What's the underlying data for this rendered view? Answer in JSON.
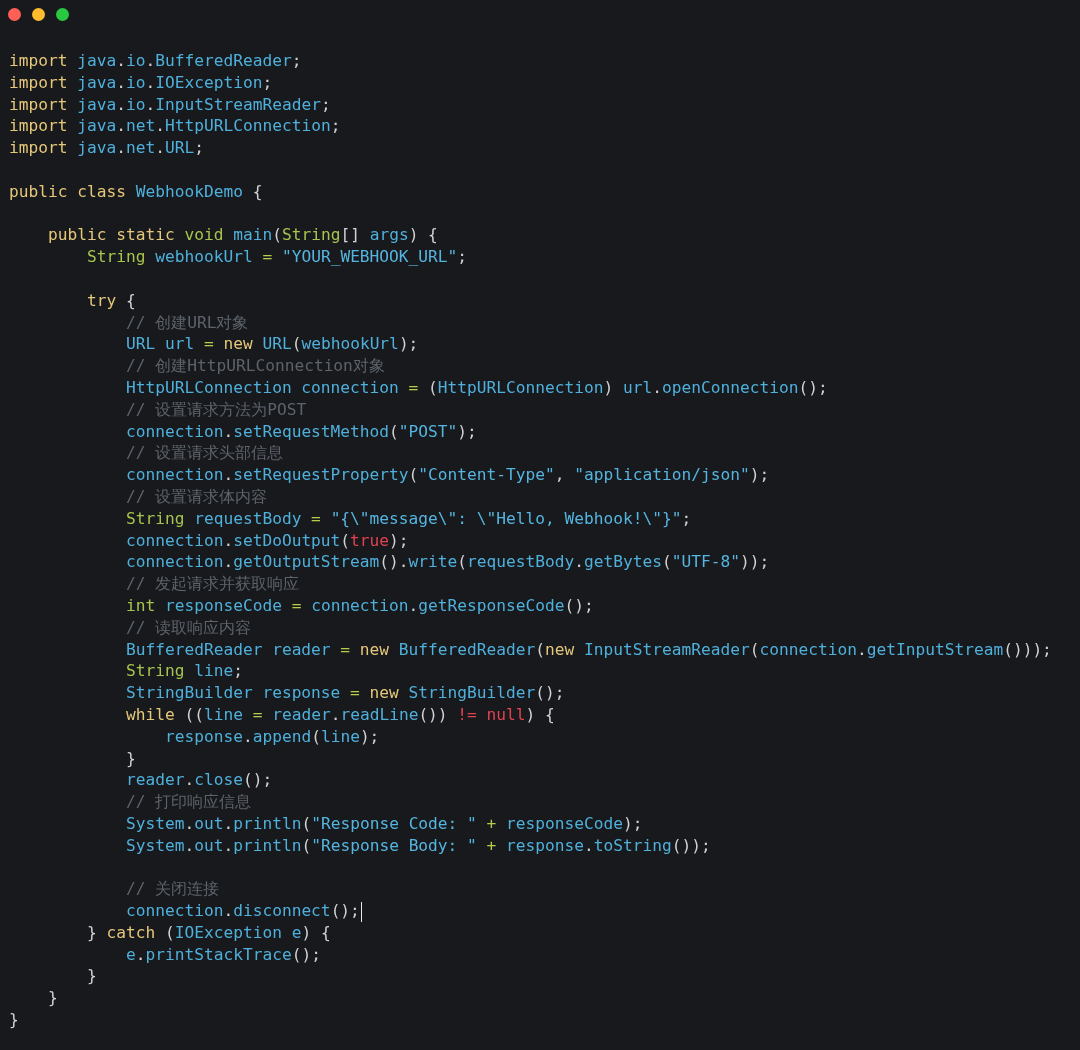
{
  "window": {
    "controls": [
      {
        "color": "#fe5f57"
      },
      {
        "color": "#febc2e"
      },
      {
        "color": "#28c840"
      }
    ]
  },
  "code": {
    "lines": [
      {
        "kind": "code",
        "cursor": false,
        "tokens": [
          {
            "kind": "keyword",
            "text": "import "
          },
          {
            "kind": "name",
            "text": "java"
          },
          {
            "kind": "punct",
            "text": "."
          },
          {
            "kind": "name",
            "text": "io"
          },
          {
            "kind": "punct",
            "text": "."
          },
          {
            "kind": "name",
            "text": "BufferedReader"
          },
          {
            "kind": "punct",
            "text": ";"
          }
        ]
      },
      {
        "kind": "code",
        "cursor": false,
        "tokens": [
          {
            "kind": "keyword",
            "text": "import "
          },
          {
            "kind": "name",
            "text": "java"
          },
          {
            "kind": "punct",
            "text": "."
          },
          {
            "kind": "name",
            "text": "io"
          },
          {
            "kind": "punct",
            "text": "."
          },
          {
            "kind": "name",
            "text": "IOException"
          },
          {
            "kind": "punct",
            "text": ";"
          }
        ]
      },
      {
        "kind": "code",
        "cursor": false,
        "tokens": [
          {
            "kind": "keyword",
            "text": "import "
          },
          {
            "kind": "name",
            "text": "java"
          },
          {
            "kind": "punct",
            "text": "."
          },
          {
            "kind": "name",
            "text": "io"
          },
          {
            "kind": "punct",
            "text": "."
          },
          {
            "kind": "name",
            "text": "InputStreamReader"
          },
          {
            "kind": "punct",
            "text": ";"
          }
        ]
      },
      {
        "kind": "code",
        "cursor": false,
        "tokens": [
          {
            "kind": "keyword",
            "text": "import "
          },
          {
            "kind": "name",
            "text": "java"
          },
          {
            "kind": "punct",
            "text": "."
          },
          {
            "kind": "name",
            "text": "net"
          },
          {
            "kind": "punct",
            "text": "."
          },
          {
            "kind": "name",
            "text": "HttpURLConnection"
          },
          {
            "kind": "punct",
            "text": ";"
          }
        ]
      },
      {
        "kind": "code",
        "cursor": false,
        "tokens": [
          {
            "kind": "keyword",
            "text": "import "
          },
          {
            "kind": "name",
            "text": "java"
          },
          {
            "kind": "punct",
            "text": "."
          },
          {
            "kind": "name",
            "text": "net"
          },
          {
            "kind": "punct",
            "text": "."
          },
          {
            "kind": "name",
            "text": "URL"
          },
          {
            "kind": "punct",
            "text": ";"
          }
        ]
      },
      {
        "kind": "blank"
      },
      {
        "kind": "code",
        "cursor": false,
        "tokens": [
          {
            "kind": "keyword",
            "text": "public class "
          },
          {
            "kind": "name",
            "text": "WebhookDemo"
          },
          {
            "kind": "punct",
            "text": " {"
          }
        ]
      },
      {
        "kind": "blank"
      },
      {
        "kind": "code",
        "cursor": false,
        "tokens": [
          {
            "kind": "keyword",
            "text": "    public static "
          },
          {
            "kind": "type",
            "text": "void "
          },
          {
            "kind": "name",
            "text": "main"
          },
          {
            "kind": "punct",
            "text": "("
          },
          {
            "kind": "type",
            "text": "String"
          },
          {
            "kind": "punct",
            "text": "[] "
          },
          {
            "kind": "name",
            "text": "args"
          },
          {
            "kind": "punct",
            "text": ") {"
          }
        ]
      },
      {
        "kind": "code",
        "cursor": false,
        "tokens": [
          {
            "kind": "type",
            "text": "        String "
          },
          {
            "kind": "name",
            "text": "webhookUrl"
          },
          {
            "kind": "operator",
            "text": " = "
          },
          {
            "kind": "string",
            "text": "\"YOUR_WEBHOOK_URL\""
          },
          {
            "kind": "punct",
            "text": ";"
          }
        ]
      },
      {
        "kind": "blank"
      },
      {
        "kind": "code",
        "cursor": false,
        "tokens": [
          {
            "kind": "keyword",
            "text": "        try"
          },
          {
            "kind": "punct",
            "text": " {"
          }
        ]
      },
      {
        "kind": "code",
        "cursor": false,
        "tokens": [
          {
            "kind": "comment",
            "text": "            // 创建URL对象"
          }
        ]
      },
      {
        "kind": "code",
        "cursor": false,
        "tokens": [
          {
            "kind": "name",
            "text": "            URL url"
          },
          {
            "kind": "operator",
            "text": " = "
          },
          {
            "kind": "keyword",
            "text": "new "
          },
          {
            "kind": "name",
            "text": "URL"
          },
          {
            "kind": "punct",
            "text": "("
          },
          {
            "kind": "name",
            "text": "webhookUrl"
          },
          {
            "kind": "punct",
            "text": ");"
          }
        ]
      },
      {
        "kind": "code",
        "cursor": false,
        "tokens": [
          {
            "kind": "comment",
            "text": "            // 创建HttpURLConnection对象"
          }
        ]
      },
      {
        "kind": "code",
        "cursor": false,
        "tokens": [
          {
            "kind": "name",
            "text": "            HttpURLConnection connection"
          },
          {
            "kind": "operator",
            "text": " = "
          },
          {
            "kind": "punct",
            "text": "("
          },
          {
            "kind": "name",
            "text": "HttpURLConnection"
          },
          {
            "kind": "punct",
            "text": ") "
          },
          {
            "kind": "name",
            "text": "url"
          },
          {
            "kind": "punct",
            "text": "."
          },
          {
            "kind": "name",
            "text": "openConnection"
          },
          {
            "kind": "punct",
            "text": "();"
          }
        ]
      },
      {
        "kind": "code",
        "cursor": false,
        "tokens": [
          {
            "kind": "comment",
            "text": "            // 设置请求方法为POST"
          }
        ]
      },
      {
        "kind": "code",
        "cursor": false,
        "tokens": [
          {
            "kind": "name",
            "text": "            connection"
          },
          {
            "kind": "punct",
            "text": "."
          },
          {
            "kind": "name",
            "text": "setRequestMethod"
          },
          {
            "kind": "punct",
            "text": "("
          },
          {
            "kind": "string",
            "text": "\"POST\""
          },
          {
            "kind": "punct",
            "text": ");"
          }
        ]
      },
      {
        "kind": "code",
        "cursor": false,
        "tokens": [
          {
            "kind": "comment",
            "text": "            // 设置请求头部信息"
          }
        ]
      },
      {
        "kind": "code",
        "cursor": false,
        "tokens": [
          {
            "kind": "name",
            "text": "            connection"
          },
          {
            "kind": "punct",
            "text": "."
          },
          {
            "kind": "name",
            "text": "setRequestProperty"
          },
          {
            "kind": "punct",
            "text": "("
          },
          {
            "kind": "string",
            "text": "\"Content-Type\""
          },
          {
            "kind": "punct",
            "text": ", "
          },
          {
            "kind": "string",
            "text": "\"application/json\""
          },
          {
            "kind": "punct",
            "text": ");"
          }
        ]
      },
      {
        "kind": "code",
        "cursor": false,
        "tokens": [
          {
            "kind": "comment",
            "text": "            // 设置请求体内容"
          }
        ]
      },
      {
        "kind": "code",
        "cursor": false,
        "tokens": [
          {
            "kind": "type",
            "text": "            String "
          },
          {
            "kind": "name",
            "text": "requestBody"
          },
          {
            "kind": "operator",
            "text": " = "
          },
          {
            "kind": "string",
            "text": "\"{\\\"message\\\": \\\"Hello, Webhook!\\\"}\""
          },
          {
            "kind": "punct",
            "text": ";"
          }
        ]
      },
      {
        "kind": "code",
        "cursor": false,
        "tokens": [
          {
            "kind": "name",
            "text": "            connection"
          },
          {
            "kind": "punct",
            "text": "."
          },
          {
            "kind": "name",
            "text": "setDoOutput"
          },
          {
            "kind": "punct",
            "text": "("
          },
          {
            "kind": "literal",
            "text": "true"
          },
          {
            "kind": "punct",
            "text": ");"
          }
        ]
      },
      {
        "kind": "code",
        "cursor": false,
        "tokens": [
          {
            "kind": "name",
            "text": "            connection"
          },
          {
            "kind": "punct",
            "text": "."
          },
          {
            "kind": "name",
            "text": "getOutputStream"
          },
          {
            "kind": "punct",
            "text": "()."
          },
          {
            "kind": "name",
            "text": "write"
          },
          {
            "kind": "punct",
            "text": "("
          },
          {
            "kind": "name",
            "text": "requestBody"
          },
          {
            "kind": "punct",
            "text": "."
          },
          {
            "kind": "name",
            "text": "getBytes"
          },
          {
            "kind": "punct",
            "text": "("
          },
          {
            "kind": "string",
            "text": "\"UTF-8\""
          },
          {
            "kind": "punct",
            "text": "));"
          }
        ]
      },
      {
        "kind": "code",
        "cursor": false,
        "tokens": [
          {
            "kind": "comment",
            "text": "            // 发起请求并获取响应"
          }
        ]
      },
      {
        "kind": "code",
        "cursor": false,
        "tokens": [
          {
            "kind": "type",
            "text": "            int "
          },
          {
            "kind": "name",
            "text": "responseCode"
          },
          {
            "kind": "operator",
            "text": " = "
          },
          {
            "kind": "name",
            "text": "connection"
          },
          {
            "kind": "punct",
            "text": "."
          },
          {
            "kind": "name",
            "text": "getResponseCode"
          },
          {
            "kind": "punct",
            "text": "();"
          }
        ]
      },
      {
        "kind": "code",
        "cursor": false,
        "tokens": [
          {
            "kind": "comment",
            "text": "            // 读取响应内容"
          }
        ]
      },
      {
        "kind": "code",
        "cursor": false,
        "tokens": [
          {
            "kind": "name",
            "text": "            BufferedReader reader"
          },
          {
            "kind": "operator",
            "text": " = "
          },
          {
            "kind": "keyword",
            "text": "new "
          },
          {
            "kind": "name",
            "text": "BufferedReader"
          },
          {
            "kind": "punct",
            "text": "("
          },
          {
            "kind": "keyword",
            "text": "new "
          },
          {
            "kind": "name",
            "text": "InputStreamReader"
          },
          {
            "kind": "punct",
            "text": "("
          },
          {
            "kind": "name",
            "text": "connection"
          },
          {
            "kind": "punct",
            "text": "."
          },
          {
            "kind": "name",
            "text": "getInputStream"
          },
          {
            "kind": "punct",
            "text": "()));"
          }
        ]
      },
      {
        "kind": "code",
        "cursor": false,
        "tokens": [
          {
            "kind": "type",
            "text": "            String "
          },
          {
            "kind": "name",
            "text": "line"
          },
          {
            "kind": "punct",
            "text": ";"
          }
        ]
      },
      {
        "kind": "code",
        "cursor": false,
        "tokens": [
          {
            "kind": "name",
            "text": "            StringBuilder response"
          },
          {
            "kind": "operator",
            "text": " = "
          },
          {
            "kind": "keyword",
            "text": "new "
          },
          {
            "kind": "name",
            "text": "StringBuilder"
          },
          {
            "kind": "punct",
            "text": "();"
          }
        ]
      },
      {
        "kind": "code",
        "cursor": false,
        "tokens": [
          {
            "kind": "keyword",
            "text": "            while"
          },
          {
            "kind": "punct",
            "text": " (("
          },
          {
            "kind": "name",
            "text": "line"
          },
          {
            "kind": "operator",
            "text": " = "
          },
          {
            "kind": "name",
            "text": "reader"
          },
          {
            "kind": "punct",
            "text": "."
          },
          {
            "kind": "name",
            "text": "readLine"
          },
          {
            "kind": "punct",
            "text": "()) "
          },
          {
            "kind": "literal",
            "text": "!= null"
          },
          {
            "kind": "punct",
            "text": ") {"
          }
        ]
      },
      {
        "kind": "code",
        "cursor": false,
        "tokens": [
          {
            "kind": "name",
            "text": "                response"
          },
          {
            "kind": "punct",
            "text": "."
          },
          {
            "kind": "name",
            "text": "append"
          },
          {
            "kind": "punct",
            "text": "("
          },
          {
            "kind": "name",
            "text": "line"
          },
          {
            "kind": "punct",
            "text": ");"
          }
        ]
      },
      {
        "kind": "code",
        "cursor": false,
        "tokens": [
          {
            "kind": "punct",
            "text": "            }"
          }
        ]
      },
      {
        "kind": "code",
        "cursor": false,
        "tokens": [
          {
            "kind": "name",
            "text": "            reader"
          },
          {
            "kind": "punct",
            "text": "."
          },
          {
            "kind": "name",
            "text": "close"
          },
          {
            "kind": "punct",
            "text": "();"
          }
        ]
      },
      {
        "kind": "code",
        "cursor": false,
        "tokens": [
          {
            "kind": "comment",
            "text": "            // 打印响应信息"
          }
        ]
      },
      {
        "kind": "code",
        "cursor": false,
        "tokens": [
          {
            "kind": "name",
            "text": "            System"
          },
          {
            "kind": "punct",
            "text": "."
          },
          {
            "kind": "name",
            "text": "out"
          },
          {
            "kind": "punct",
            "text": "."
          },
          {
            "kind": "name",
            "text": "println"
          },
          {
            "kind": "punct",
            "text": "("
          },
          {
            "kind": "string",
            "text": "\"Response Code: \""
          },
          {
            "kind": "operator",
            "text": " + "
          },
          {
            "kind": "name",
            "text": "responseCode"
          },
          {
            "kind": "punct",
            "text": ");"
          }
        ]
      },
      {
        "kind": "code",
        "cursor": false,
        "tokens": [
          {
            "kind": "name",
            "text": "            System"
          },
          {
            "kind": "punct",
            "text": "."
          },
          {
            "kind": "name",
            "text": "out"
          },
          {
            "kind": "punct",
            "text": "."
          },
          {
            "kind": "name",
            "text": "println"
          },
          {
            "kind": "punct",
            "text": "("
          },
          {
            "kind": "string",
            "text": "\"Response Body: \""
          },
          {
            "kind": "operator",
            "text": " + "
          },
          {
            "kind": "name",
            "text": "response"
          },
          {
            "kind": "punct",
            "text": "."
          },
          {
            "kind": "name",
            "text": "toString"
          },
          {
            "kind": "punct",
            "text": "());"
          }
        ]
      },
      {
        "kind": "blank"
      },
      {
        "kind": "code",
        "cursor": false,
        "tokens": [
          {
            "kind": "comment",
            "text": "            // 关闭连接"
          }
        ]
      },
      {
        "kind": "code",
        "cursor": true,
        "tokens": [
          {
            "kind": "name",
            "text": "            connection"
          },
          {
            "kind": "punct",
            "text": "."
          },
          {
            "kind": "name",
            "text": "disconnect"
          },
          {
            "kind": "punct",
            "text": "();"
          }
        ]
      },
      {
        "kind": "code",
        "cursor": false,
        "tokens": [
          {
            "kind": "punct",
            "text": "        } "
          },
          {
            "kind": "keyword",
            "text": "catch"
          },
          {
            "kind": "punct",
            "text": " ("
          },
          {
            "kind": "name",
            "text": "IOException e"
          },
          {
            "kind": "punct",
            "text": ") {"
          }
        ]
      },
      {
        "kind": "code",
        "cursor": false,
        "tokens": [
          {
            "kind": "name",
            "text": "            e"
          },
          {
            "kind": "punct",
            "text": "."
          },
          {
            "kind": "name",
            "text": "printStackTrace"
          },
          {
            "kind": "punct",
            "text": "();"
          }
        ]
      },
      {
        "kind": "code",
        "cursor": false,
        "tokens": [
          {
            "kind": "punct",
            "text": "        }"
          }
        ]
      },
      {
        "kind": "code",
        "cursor": false,
        "tokens": [
          {
            "kind": "punct",
            "text": "    }"
          }
        ]
      },
      {
        "kind": "code",
        "cursor": false,
        "tokens": [
          {
            "kind": "punct",
            "text": "}"
          }
        ]
      }
    ]
  }
}
